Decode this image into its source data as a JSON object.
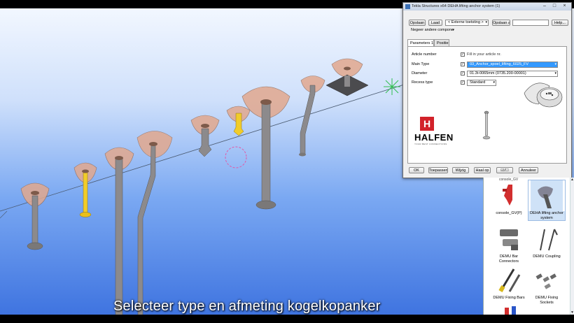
{
  "subtitle": "Selecteer type en afmeting kogelkopanker",
  "dialog": {
    "title": "Tekla Structures x64  DEHA lifting anchor system (1)",
    "window_controls": [
      "–",
      "□",
      "×"
    ],
    "toolbar": {
      "save_btn": "Opslaan",
      "load_btn": "Laad",
      "load_value": "< Externe toetsting >",
      "saveas_btn": "Opslaan al",
      "saveas_value": "",
      "help_btn": "Help...",
      "ignore_value": "Negeer andere compone"
    },
    "tabs": [
      "Parameters 1",
      "Positie"
    ],
    "params": [
      {
        "label": "Article number",
        "checked": "✓",
        "value": "Fill in your article nr."
      },
      {
        "label": "Main Type",
        "checked": "✓",
        "value": "03_Anchor_spoel_lifting_6025_FV"
      },
      {
        "label": "Diameter",
        "checked": "✓",
        "value": "01.3t-0065mm (0735.200-00001)"
      },
      {
        "label": "Recess type",
        "checked": "✓",
        "value": "Standard"
      }
    ],
    "brand": {
      "letter": "H",
      "name": "HALFEN",
      "slogan": "YOUR BEST CONNECTIONS"
    },
    "bottom_buttons": [
      "OK",
      "Toepassen",
      "Wijzig",
      "Haal op",
      "☑/☐",
      "Annuleer"
    ]
  },
  "catalog": {
    "items": [
      {
        "label": "console_GV(P)",
        "selected": false
      },
      {
        "label": "DEHA lifting anchor system",
        "selected": true
      },
      {
        "label": "DEMU Bar Connectors",
        "selected": false
      },
      {
        "label": "DEMU Coupling",
        "selected": false
      },
      {
        "label": "DEMU Fixing Bars",
        "selected": false
      },
      {
        "label": "DEMU Fixing Sockets",
        "selected": false
      }
    ],
    "top_label": "console_GV"
  },
  "colors": {
    "anchor_body": "#8c8a8c",
    "head": "#e2a88e",
    "highlight": "#f1cc2a",
    "brand_red": "#d2222a",
    "selection": "#3399ff"
  }
}
